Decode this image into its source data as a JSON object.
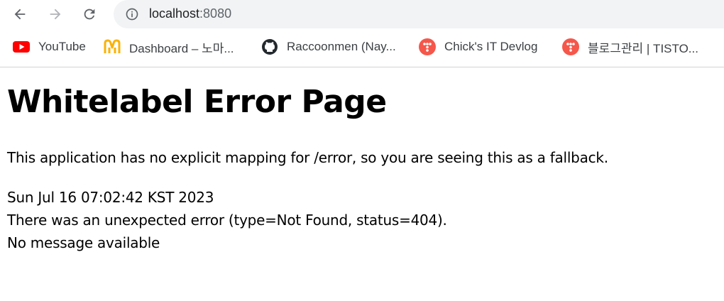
{
  "toolbar": {
    "back_icon": "arrow-back-icon",
    "forward_icon": "arrow-forward-icon",
    "reload_icon": "reload-icon",
    "info_icon": "info-icon",
    "url_host": "localhost",
    "url_port": ":8080"
  },
  "bookmarks": [
    {
      "label": "YouTube",
      "icon": "youtube-icon",
      "color": "#ff0000"
    },
    {
      "label": "Dashboard – 노마...",
      "icon": "nomad-logo-icon",
      "color": "#f9b208"
    },
    {
      "label": "Raccoonmen (Nay...",
      "icon": "github-icon",
      "color": "#24292e"
    },
    {
      "label": "Chick's IT Devlog",
      "icon": "tistory-icon",
      "color": "#f5574b"
    },
    {
      "label": "블로그관리 | TISTO...",
      "icon": "tistory-icon",
      "color": "#f5574b"
    }
  ],
  "page": {
    "title": "Whitelabel Error Page",
    "description": "This application has no explicit mapping for /error, so you are seeing this as a fallback.",
    "timestamp": "Sun Jul 16 07:02:42 KST 2023",
    "error_line": "There was an unexpected error (type=Not Found, status=404).",
    "message": "No message available"
  }
}
